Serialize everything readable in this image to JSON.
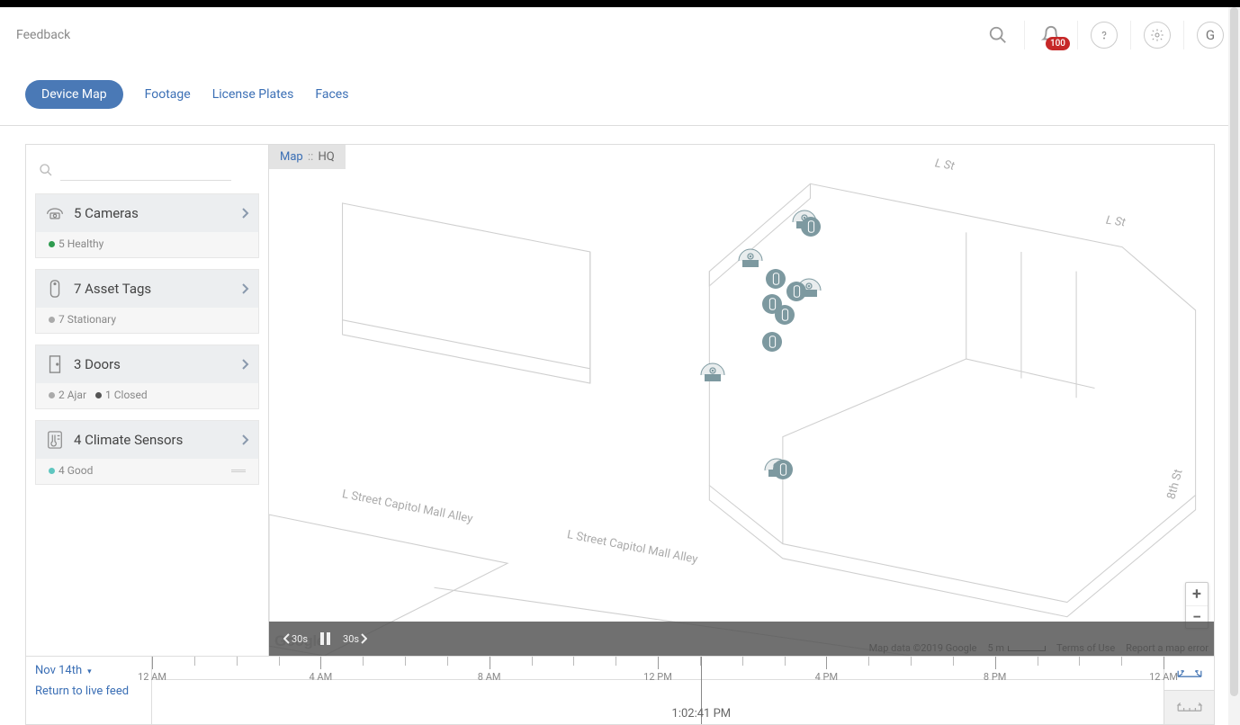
{
  "header": {
    "feedback": "Feedback",
    "notification_count": "100",
    "avatar_initial": "G"
  },
  "tabs": [
    {
      "label": "Device Map",
      "active": true
    },
    {
      "label": "Footage",
      "active": false
    },
    {
      "label": "License Plates",
      "active": false
    },
    {
      "label": "Faces",
      "active": false
    }
  ],
  "breadcrumb": {
    "root": "Map",
    "sep": "::",
    "leaf": "HQ"
  },
  "search_placeholder": "",
  "cards": [
    {
      "icon": "camera",
      "title": "5 Cameras",
      "statuses": [
        {
          "dot": "d-green",
          "text": "5 Healthy"
        }
      ]
    },
    {
      "icon": "tag",
      "title": "7 Asset Tags",
      "statuses": [
        {
          "dot": "d-gray",
          "text": "7 Stationary"
        }
      ]
    },
    {
      "icon": "door",
      "title": "3 Doors",
      "statuses": [
        {
          "dot": "d-gray",
          "text": "2 Ajar"
        },
        {
          "dot": "d-dark",
          "text": "1 Closed"
        }
      ]
    },
    {
      "icon": "climate",
      "title": "4 Climate Sensors",
      "statuses": [
        {
          "dot": "d-teal",
          "text": "4 Good"
        }
      ]
    }
  ],
  "streets": {
    "lst1": "L St",
    "lst2": "L St",
    "alley1": "L Street Capitol Mall Alley",
    "alley2": "L Street Capitol Mall Alley",
    "eighth": "8th St"
  },
  "map_footer": {
    "attribution": "Map data ©2019 Google",
    "scale": "5 m",
    "terms": "Terms of Use",
    "report": "Report a map error",
    "google": "Google"
  },
  "playback": {
    "back": "30s",
    "forward": "30s"
  },
  "timeline": {
    "date": "Nov 14th",
    "return": "Return to live feed",
    "hours": [
      "12 AM",
      "4 AM",
      "8 AM",
      "12 PM",
      "4 PM",
      "8 PM",
      "12 AM"
    ],
    "current_time": "1:02:41 PM",
    "cursor_pct": 54.3
  }
}
